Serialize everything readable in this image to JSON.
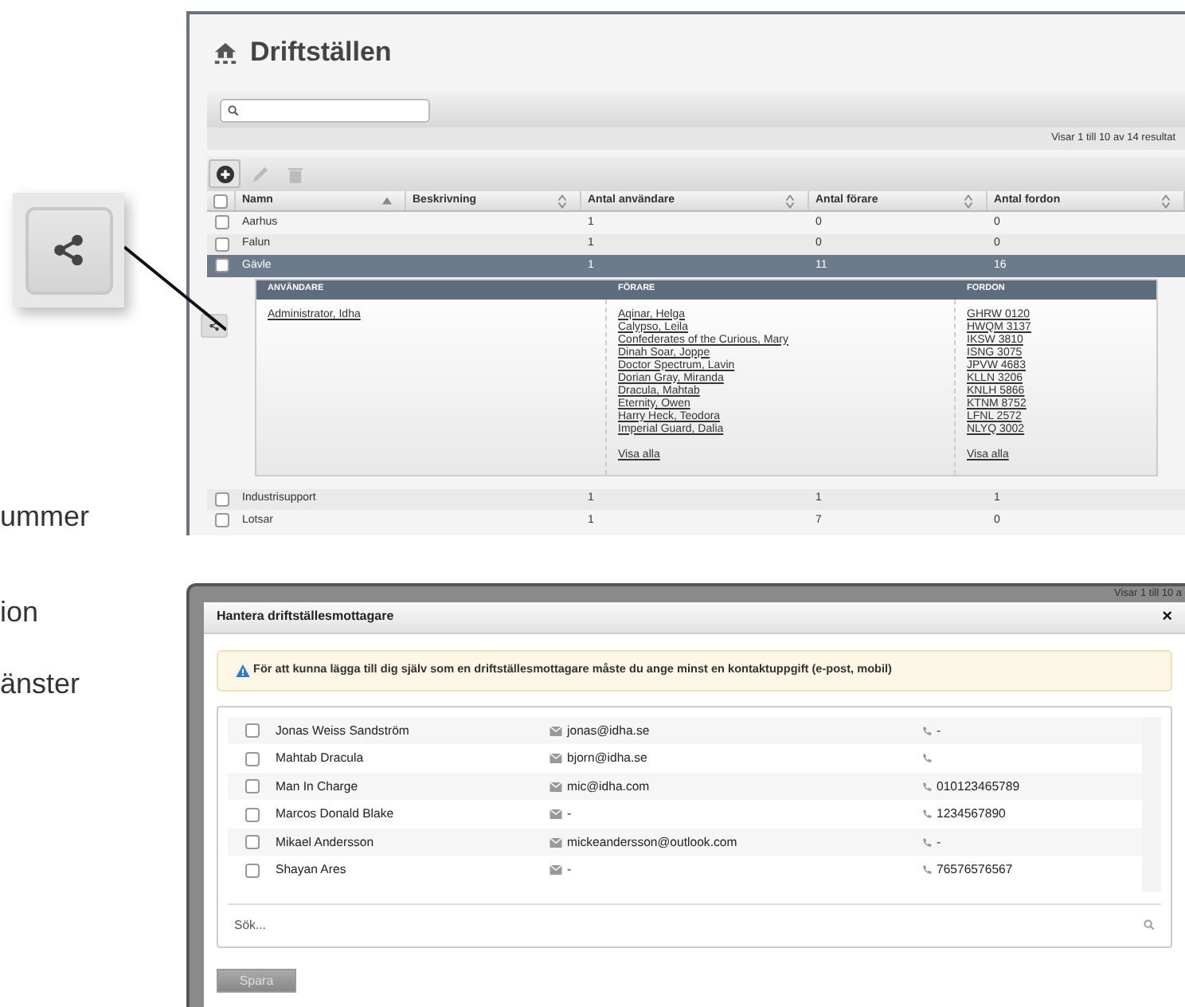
{
  "doc_text": [
    "ummer",
    "ion",
    "änster"
  ],
  "list_view": {
    "title": "Driftställen",
    "result_summary": "Visar 1 till 10 av 14 resultat",
    "toolbar": [
      {
        "kind": "add",
        "disabled": false
      },
      {
        "kind": "edit",
        "disabled": true
      },
      {
        "kind": "delete",
        "disabled": true
      }
    ],
    "select_all_checked": false,
    "columns": [
      {
        "label": "Namn",
        "sorted": true
      },
      {
        "label": "Beskrivning",
        "sorted": false
      },
      {
        "label": "Antal användare",
        "sorted": false
      },
      {
        "label": "Antal förare",
        "sorted": false
      },
      {
        "label": "Antal fordon",
        "sorted": false
      }
    ],
    "rows": [
      {
        "name": "Aarhus",
        "users": "1",
        "drivers": "0",
        "vehicles": "0",
        "selected": false,
        "checked": false
      },
      {
        "name": "Falun",
        "users": "1",
        "drivers": "0",
        "vehicles": "0",
        "selected": false,
        "checked": false
      },
      {
        "name": "Gävle",
        "users": "1",
        "drivers": "11",
        "vehicles": "16",
        "selected": true,
        "checked": false,
        "detail": {
          "headers": [
            "ANVÄNDARE",
            "FÖRARE",
            "FORDON"
          ],
          "users": [
            "Administrator, Idha"
          ],
          "drivers": [
            "Aqinar, Helga",
            "Calypso, Leila",
            "Confederates of the Curious, Mary",
            "Dinah Soar, Joppe",
            "Doctor Spectrum, Lavin",
            "Dorian Gray, Miranda",
            "Dracula, Mahtab",
            "Eternity, Owen",
            "Harry Heck, Teodora",
            "Imperial Guard, Dalia"
          ],
          "vehicles": [
            "GHRW 0120",
            "HWQM 3137",
            "IKSW 3810",
            "ISNG 3075",
            "JPVW 4683",
            "KLLN 3206",
            "KNLH 5866",
            "KTNM 8752",
            "LFNL 2572",
            "NLYQ 3002"
          ],
          "drivers_show_all": "Visa alla",
          "vehicles_show_all": "Visa alla"
        }
      },
      {
        "name": "Industrisupport",
        "users": "1",
        "drivers": "1",
        "vehicles": "1",
        "selected": false,
        "checked": false
      },
      {
        "name": "Lotsar",
        "users": "1",
        "drivers": "7",
        "vehicles": "0",
        "selected": false,
        "checked": false
      }
    ]
  },
  "modal": {
    "background_text": "Visar 1 till 10 a",
    "title": "Hantera driftställesmottagare",
    "close": "×",
    "warning": "För att kunna lägga till dig själv som en driftställesmottagare måste du ange minst en kontaktuppgift (e-post, mobil)",
    "recipients": [
      {
        "name": "Jonas Weiss Sandström",
        "email": "jonas@idha.se",
        "phone": "-",
        "checked": false
      },
      {
        "name": "Mahtab Dracula",
        "email": "bjorn@idha.se",
        "checked": false
      },
      {
        "name": "Man In Charge",
        "email": "mic@idha.com",
        "phone": "010123465789",
        "checked": false
      },
      {
        "name": "Marcos Donald Blake",
        "email": "-",
        "phone": "1234567890",
        "checked": false
      },
      {
        "name": "Mikael Andersson",
        "email": "mickeandersson@outlook.com",
        "phone": "-",
        "checked": false
      },
      {
        "name": "Shayan Ares",
        "email": "-",
        "phone": "76576576567",
        "checked": false
      }
    ],
    "search": {
      "placeholder": "Sök..."
    },
    "save_button": {
      "label": "Spara",
      "disabled": true
    }
  }
}
